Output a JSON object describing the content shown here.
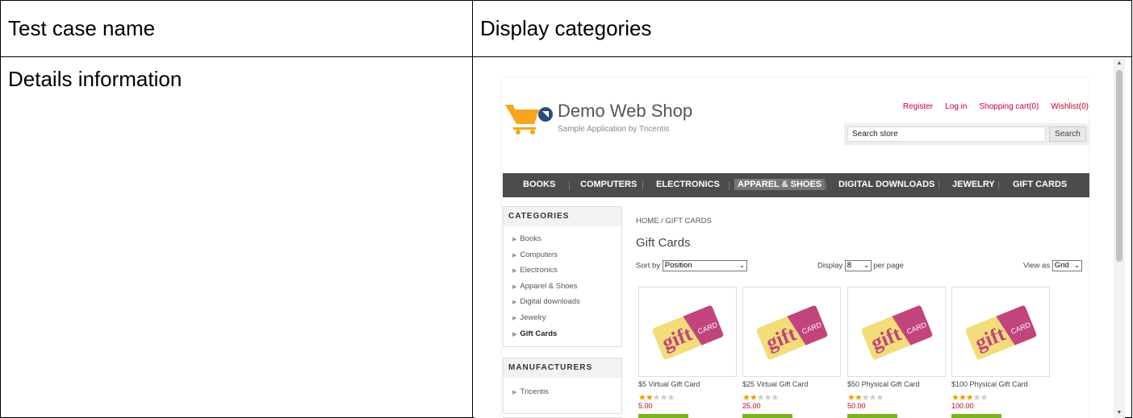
{
  "table": {
    "test_case_label": "Test case name",
    "test_case_value": "Display categories",
    "details_label": "Details information"
  },
  "shop": {
    "logo_title": "Demo Web Shop",
    "logo_subtitle": "Sample Application by Tricentis",
    "header_links": [
      "Register",
      "Log in",
      "Shopping cart(0)",
      "Wishlist(0)"
    ],
    "search_value": "Search store",
    "search_button": "Search",
    "menu": [
      "BOOKS",
      "COMPUTERS",
      "ELECTRONICS",
      "APPAREL & SHOES",
      "DIGITAL DOWNLOADS",
      "JEWELRY",
      "GIFT CARDS"
    ],
    "active_menu": "APPAREL & SHOES",
    "categories_title": "CATEGORIES",
    "categories": [
      "Books",
      "Computers",
      "Electronics",
      "Apparel & Shoes",
      "Digital downloads",
      "Jewelry",
      "Gift Cards"
    ],
    "selected_category": "Gift Cards",
    "manufacturers_title": "MANUFACTURERS",
    "manufacturers": [
      "Tricentis"
    ],
    "breadcrumb_home": "HOME",
    "breadcrumb_sep": "/",
    "breadcrumb_current": "GIFT CARDS",
    "page_title": "Gift Cards",
    "sort_label": "Sort by",
    "sort_value": "Position",
    "display_label": "Display",
    "display_value": "8",
    "per_page_label": "per page",
    "view_label": "View as",
    "view_value": "Grid",
    "products": [
      {
        "name": "$5 Virtual Gift Card",
        "rating": 2,
        "price": "5.00"
      },
      {
        "name": "$25 Virtual Gift Card",
        "rating": 2,
        "price": "25.00"
      },
      {
        "name": "$50 Physical Gift Card",
        "rating": 2,
        "price": "50.00"
      },
      {
        "name": "$100 Physical Gift Card",
        "rating": 3,
        "price": "100.00"
      }
    ],
    "gift_text": "gift",
    "card_text": "CARD",
    "colors": {
      "brand_red": "#c3002f",
      "menu_bg": "#4c4c4c",
      "logo_orange": "#f7a51c",
      "add_button": "#7ab31f",
      "card_yellow": "#f3dd7a",
      "card_pink": "#c2447d"
    }
  }
}
